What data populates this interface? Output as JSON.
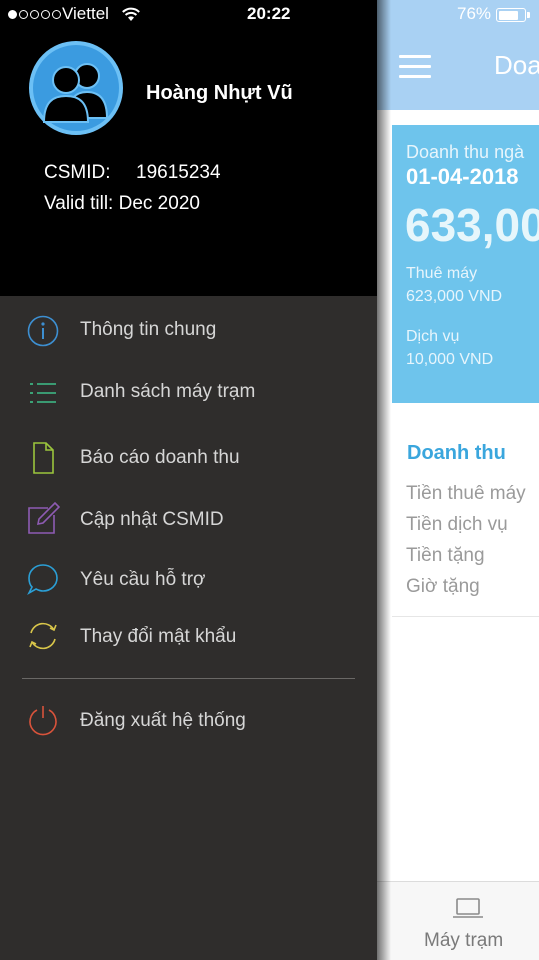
{
  "status_bar": {
    "carrier": "Viettel",
    "time": "20:22",
    "battery": "76%",
    "battery_level": 0.76,
    "signal_bars": 1
  },
  "drawer": {
    "user": {
      "name": "Hoàng Nhựt Vũ",
      "csmid_label": "CSMID:",
      "csmid_value": "19615234",
      "valid_till": "Valid till: Dec 2020"
    },
    "menu": [
      {
        "label": "Thông tin chung",
        "icon": "info-icon",
        "color": "#3d8fd1"
      },
      {
        "label": "Danh sách máy trạm",
        "icon": "list-icon",
        "color": "#3fbf8a"
      },
      {
        "label": "Báo cáo doanh thu",
        "icon": "document-icon",
        "color": "#9bc53d"
      },
      {
        "label": "Cập nhật CSMID",
        "icon": "edit-icon",
        "color": "#8e5bb3"
      },
      {
        "label": "Yêu cầu hỗ trợ",
        "icon": "chat-icon",
        "color": "#2b9fd6"
      },
      {
        "label": "Thay đổi mật khẩu",
        "icon": "refresh-icon",
        "color": "#d9c64a"
      }
    ],
    "logout": {
      "label": "Đăng xuất hệ thống",
      "icon": "power-icon",
      "color": "#d9533b"
    }
  },
  "app": {
    "title": "Doa",
    "card": {
      "label": "Doanh thu ngà",
      "date": "01-04-2018",
      "total": "633,00",
      "rent_label": "Thuê máy",
      "rent_value": "623,000 VND",
      "service_label": "Dịch vụ",
      "service_value": "10,000 VND"
    },
    "section": {
      "title": "Doanh thu",
      "items": [
        "Tiền thuê máy",
        "Tiền dịch vụ",
        "Tiền tặng",
        "Giờ tặng"
      ]
    },
    "tabbar": {
      "label": "Máy trạm",
      "icon": "laptop-icon"
    }
  },
  "colors": {
    "drawer_bg": "#2f2d2c",
    "header_bg": "#000000",
    "app_header": "#a9d1f3",
    "card_bg": "#6ec4ec",
    "accent": "#3aa6dd"
  }
}
